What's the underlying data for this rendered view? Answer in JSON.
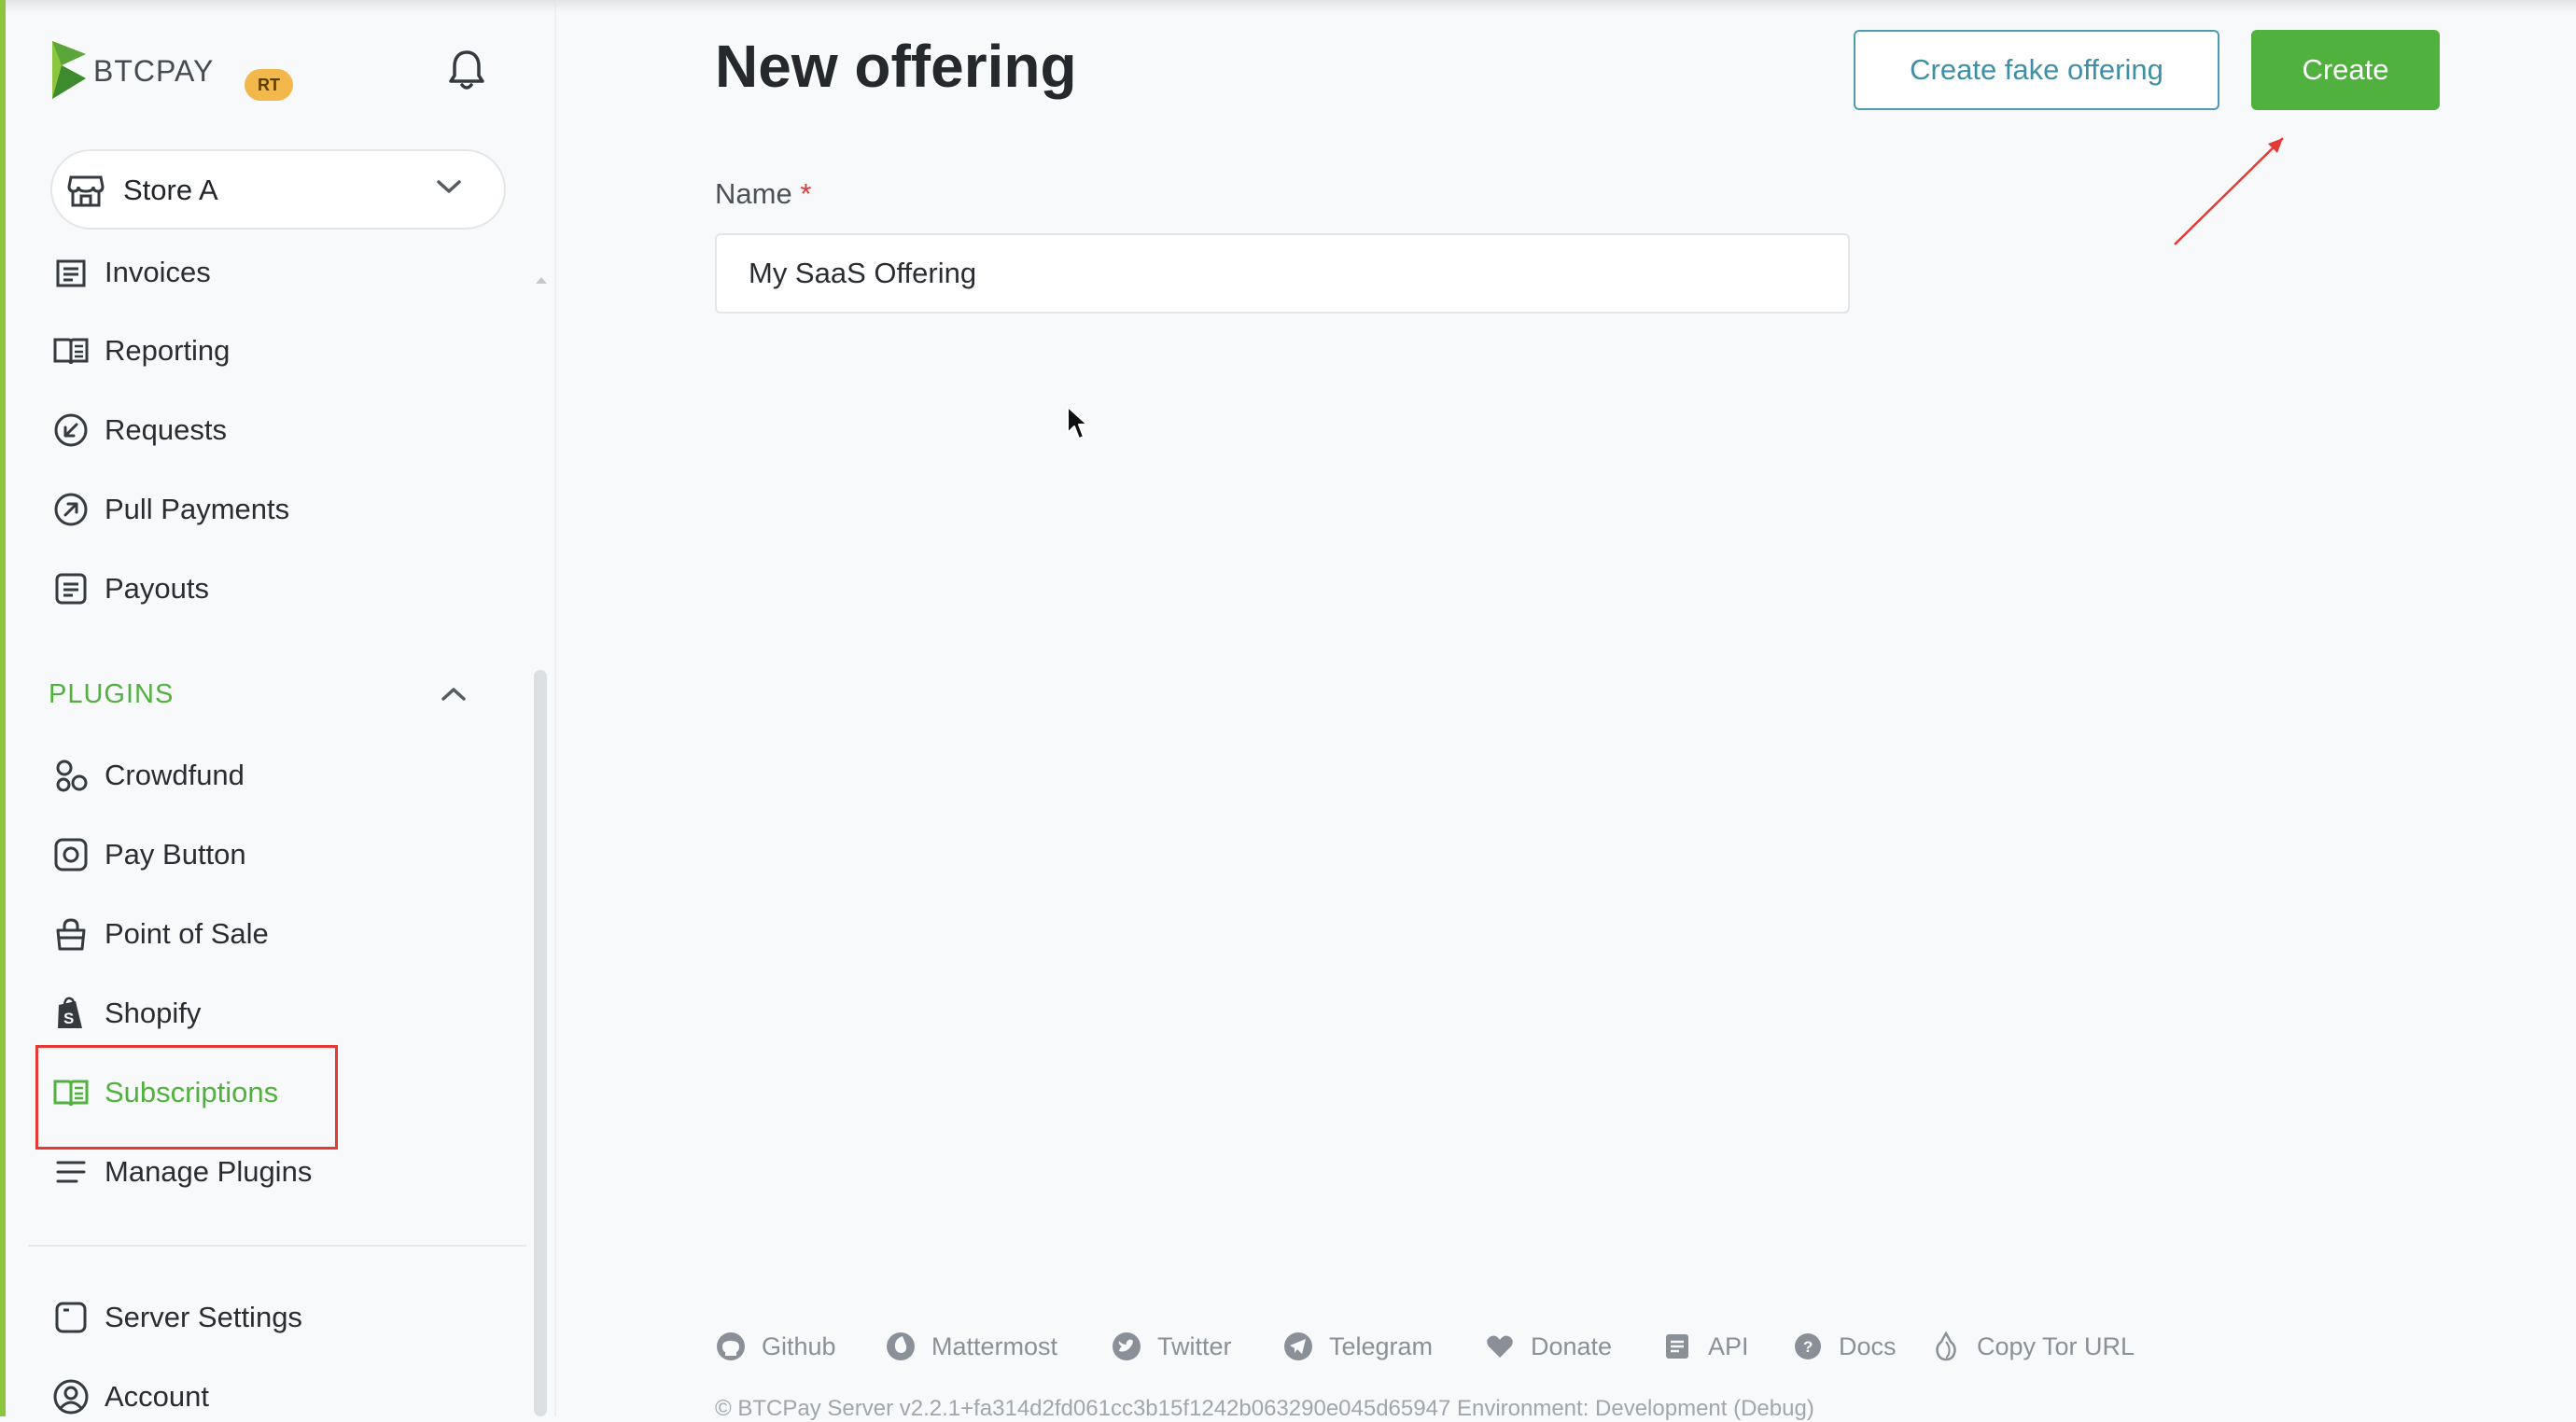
{
  "header": {
    "logo_text": "BTCPAY",
    "badge": "RT",
    "page_title": "New offering",
    "create_fake_label": "Create fake offering",
    "create_label": "Create"
  },
  "store": {
    "name": "Store A"
  },
  "sidebar": {
    "items": [
      {
        "label": "Invoices",
        "icon": "invoice-icon"
      },
      {
        "label": "Reporting",
        "icon": "book-icon"
      },
      {
        "label": "Requests",
        "icon": "arrow-in-circle-icon"
      },
      {
        "label": "Pull Payments",
        "icon": "arrow-out-circle-icon"
      },
      {
        "label": "Payouts",
        "icon": "document-icon"
      }
    ],
    "plugins_header": "PLUGINS",
    "plugins": [
      {
        "label": "Crowdfund",
        "icon": "crowdfund-icon"
      },
      {
        "label": "Pay Button",
        "icon": "pay-button-icon"
      },
      {
        "label": "Point of Sale",
        "icon": "shopping-bag-icon"
      },
      {
        "label": "Shopify",
        "icon": "shopify-icon"
      },
      {
        "label": "Subscriptions",
        "icon": "book-icon",
        "active": true
      },
      {
        "label": "Manage Plugins",
        "icon": "menu-icon"
      }
    ],
    "bottom": [
      {
        "label": "Server Settings",
        "icon": "server-icon"
      },
      {
        "label": "Account",
        "icon": "account-icon"
      }
    ]
  },
  "form": {
    "name_label": "Name",
    "required_mark": "*",
    "name_value": "My SaaS Offering"
  },
  "footer": {
    "links": [
      {
        "label": "Github",
        "icon": "github-icon"
      },
      {
        "label": "Mattermost",
        "icon": "mattermost-icon"
      },
      {
        "label": "Twitter",
        "icon": "twitter-icon"
      },
      {
        "label": "Telegram",
        "icon": "telegram-icon"
      },
      {
        "label": "Donate",
        "icon": "heart-icon"
      },
      {
        "label": "API",
        "icon": "api-icon"
      },
      {
        "label": "Docs",
        "icon": "docs-icon"
      },
      {
        "label": "Copy Tor URL",
        "icon": "onion-icon"
      }
    ],
    "meta": "© BTCPay Server v2.2.1+fa314d2fd061cc3b15f1242b063290e045d65947 Environment: Development (Debug)"
  },
  "colors": {
    "accent": "#51b13e",
    "outline": "#4c9bb0",
    "highlight": "#e53935",
    "sidebar_bar": "#8cc63f"
  }
}
